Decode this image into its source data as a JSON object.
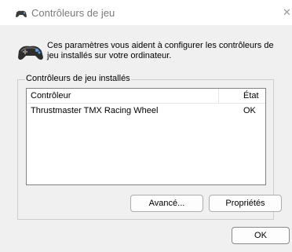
{
  "window": {
    "title": "Contrôleurs de jeu",
    "close_symbol": "✕"
  },
  "header": {
    "icon": "gamepad-icon",
    "description": "Ces paramètres vous aident à configurer les contrôleurs de jeu installés sur votre ordinateur."
  },
  "group": {
    "label": "Contrôleurs de jeu installés",
    "columns": {
      "controller": "Contrôleur",
      "state": "État"
    },
    "rows": [
      {
        "controller": "Thrustmaster TMX Racing Wheel",
        "state": "OK"
      }
    ]
  },
  "buttons": {
    "advanced": "Avancé...",
    "properties": "Propriétés",
    "ok": "OK"
  }
}
